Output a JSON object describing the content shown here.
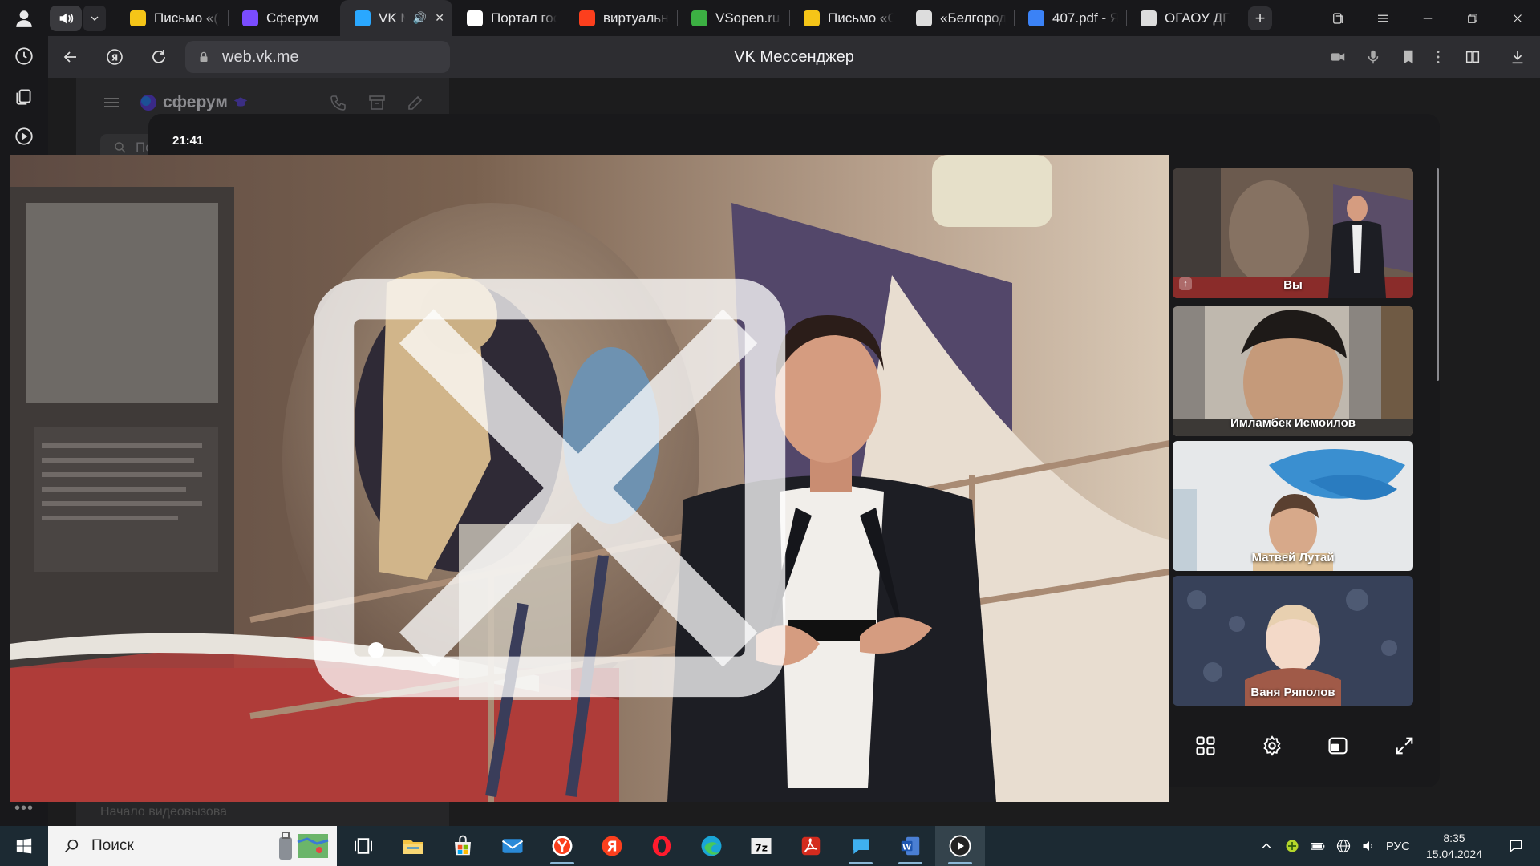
{
  "browser": {
    "tabs": [
      {
        "title": "Письмо «(Б",
        "favicon": "mail-icon",
        "color": "#f5c518",
        "active": false
      },
      {
        "title": "Сферум",
        "favicon": "sferum-icon",
        "color": "#7a4cff",
        "active": false
      },
      {
        "title": "VK Ме",
        "favicon": "vk-messenger-icon",
        "color": "#2aa8ff",
        "active": true,
        "audio": "🔊",
        "close": "✕"
      },
      {
        "title": "Портал гос",
        "favicon": "gosuslugi-icon",
        "color": "#ffffff",
        "active": false
      },
      {
        "title": "виртуальн",
        "favicon": "yandex-icon",
        "color": "#fc3f1d",
        "active": false
      },
      {
        "title": "VSopen.ru",
        "favicon": "vsopen-icon",
        "color": "#3cb043",
        "active": false
      },
      {
        "title": "Письмо «О",
        "favicon": "mail-icon",
        "color": "#f5c518",
        "active": false
      },
      {
        "title": "«Белгород",
        "favicon": "person-icon",
        "color": "#dddddd",
        "active": false
      },
      {
        "title": "407.pdf - Я",
        "favicon": "pdf-icon",
        "color": "#3b82f6",
        "active": false
      },
      {
        "title": "ОГАОУ ДП",
        "favicon": "person-icon",
        "color": "#dddddd",
        "active": false
      }
    ],
    "new_tab": "+",
    "url": "web.vk.me",
    "page_title": "VK Мессенджер"
  },
  "vk": {
    "brand": "сферум",
    "search_placeholder": "Поиск",
    "footer_hint": "Начало видеовызова"
  },
  "call": {
    "time": "21:41",
    "participants": [
      {
        "name": "Вы",
        "badge": "↑"
      },
      {
        "name": "Имламбек Исмоилов"
      },
      {
        "name": "Матвей Лутай"
      },
      {
        "name": "Ваня Ряполов"
      }
    ]
  },
  "taskbar": {
    "search_label": "Поиск",
    "language": "РУС",
    "time": "8:35",
    "date": "15.04.2024"
  },
  "colors": {
    "accent": "#2aa8ff",
    "taskbar": "#1c2a33",
    "modal": "#19191b"
  }
}
